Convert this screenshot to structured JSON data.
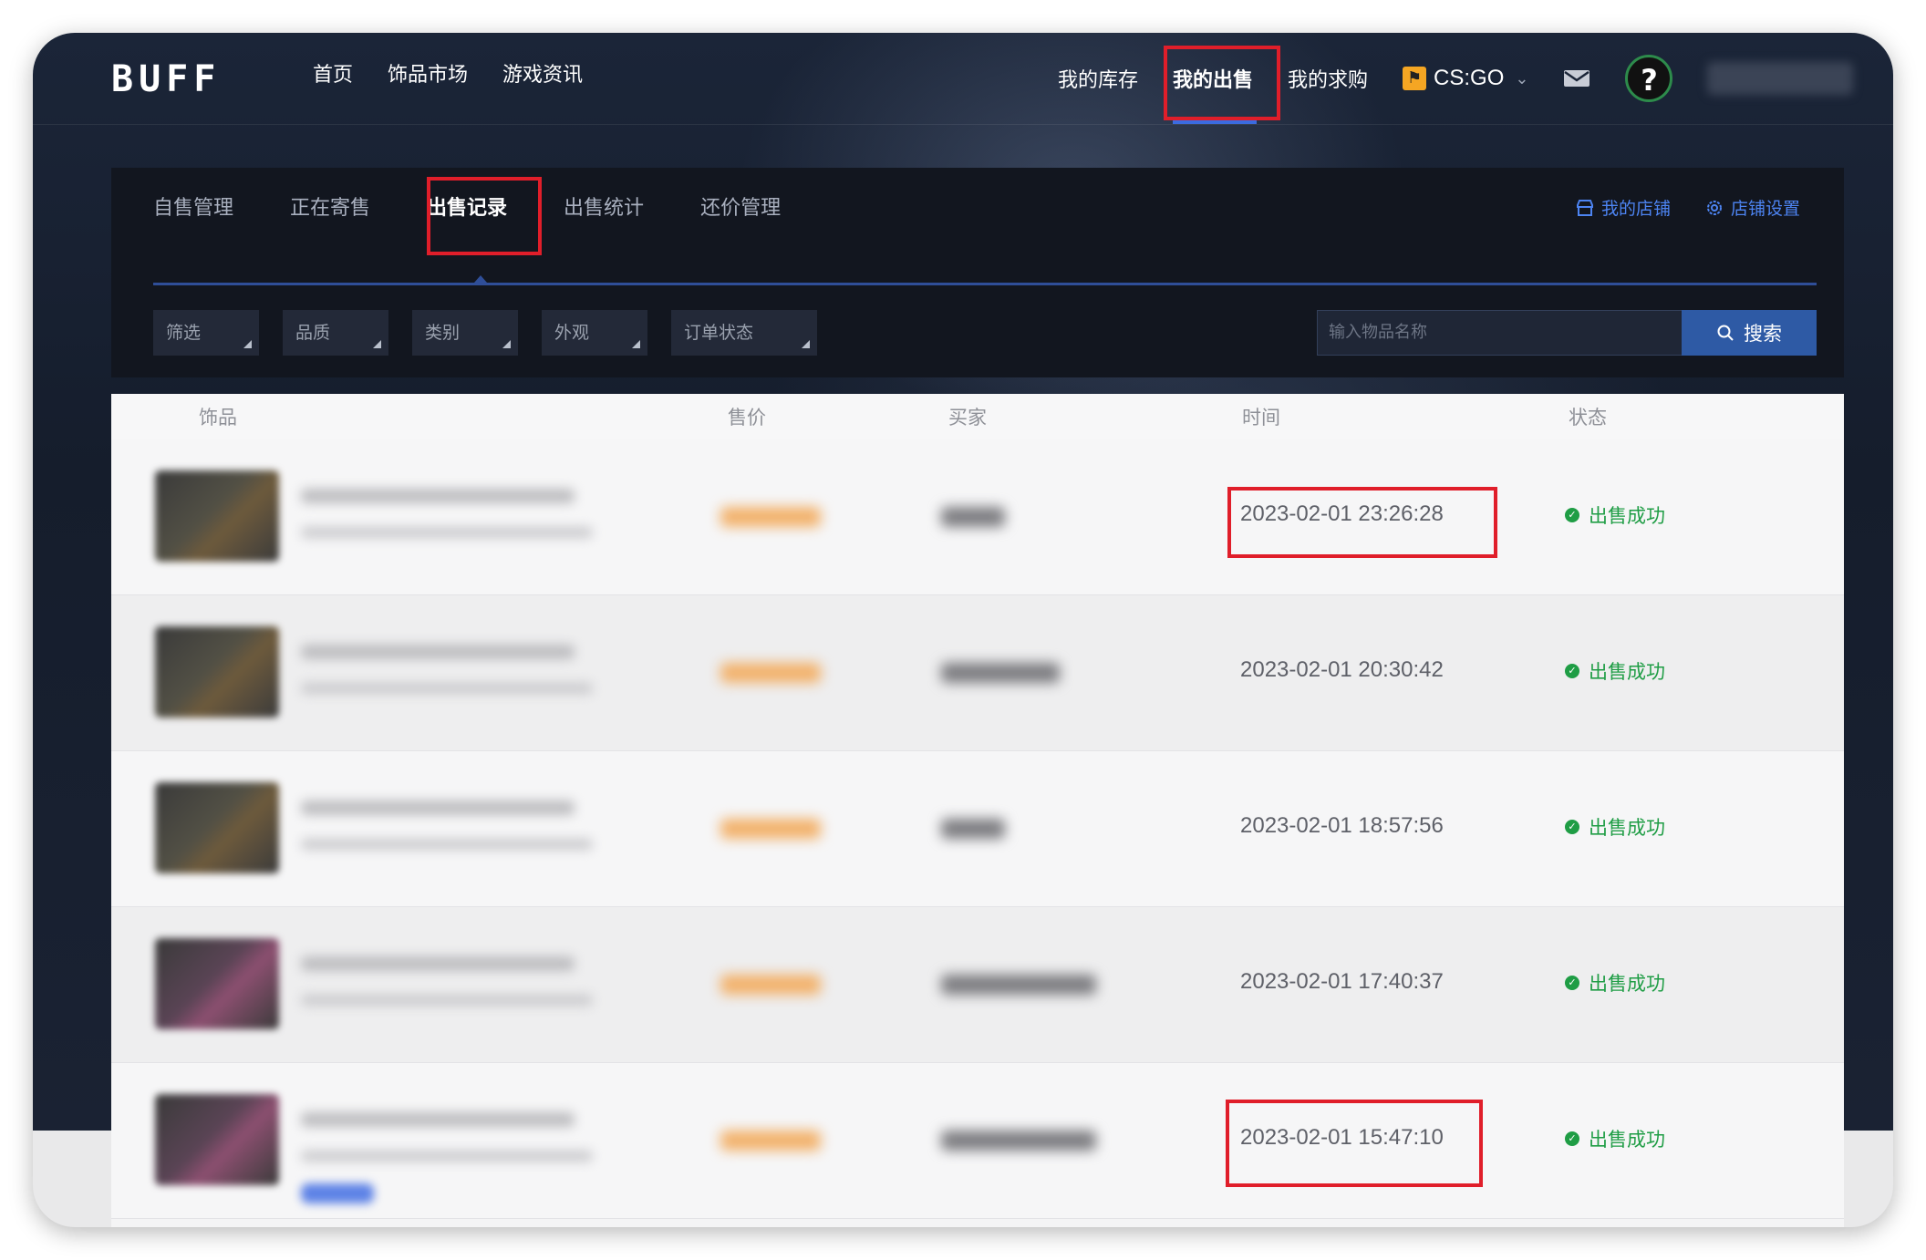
{
  "app": {
    "logo": "BUFF"
  },
  "top_nav": {
    "left": [
      "首页",
      "饰品市场",
      "游戏资讯"
    ],
    "right": [
      "我的库存",
      "我的出售",
      "我的求购"
    ],
    "game": "CS:GO",
    "help": "?"
  },
  "panel": {
    "tabs": [
      "自售管理",
      "正在寄售",
      "出售记录",
      "出售统计",
      "还价管理"
    ],
    "active_tab": "出售记录",
    "shop_links": {
      "my_shop": "我的店铺",
      "shop_settings": "店铺设置"
    },
    "filters": [
      "筛选",
      "品质",
      "类别",
      "外观",
      "订单状态"
    ],
    "search": {
      "placeholder": "输入物品名称",
      "button": "搜索"
    }
  },
  "table": {
    "headers": [
      "饰品",
      "售价",
      "买家",
      "时间",
      "状态"
    ],
    "rows": [
      {
        "time": "2023-02-01 23:26:28",
        "status": "出售成功"
      },
      {
        "time": "2023-02-01 20:30:42",
        "status": "出售成功"
      },
      {
        "time": "2023-02-01 18:57:56",
        "status": "出售成功"
      },
      {
        "time": "2023-02-01 17:40:37",
        "status": "出售成功"
      },
      {
        "time": "2023-02-01 15:47:10",
        "status": "出售成功"
      }
    ]
  },
  "colors": {
    "accent": "#3b6be0",
    "success": "#1f9d45",
    "annotation": "#e01e2a",
    "price": "#f2b16a"
  }
}
